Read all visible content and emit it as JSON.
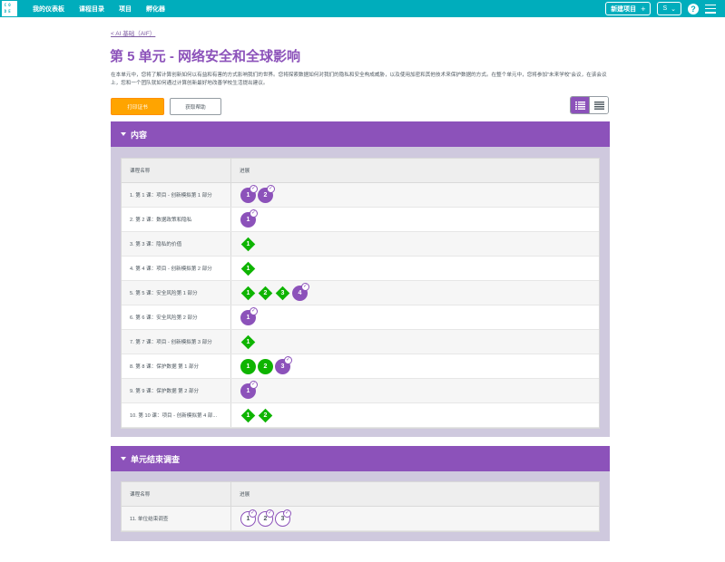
{
  "header": {
    "logo_letters": [
      "C",
      "O",
      "",
      "D",
      "E",
      ""
    ],
    "nav": [
      "我的仪表板",
      "课程目录",
      "项目",
      "孵化器"
    ],
    "new_project_label": "新建项目",
    "new_project_icon": "plus-icon",
    "user_label": "S",
    "help_label": "?"
  },
  "breadcrumb": "< AI 基础（AIF）",
  "title": "第 5 单元 - 网络安全和全球影响",
  "description": "在本单元中，您将了解计算创新如何以有益和有害的方式影响我们的世界。您将探索数据如何对我们的隐私和安全构成威胁，以及使用加密和其他技术来保护数据的方式。在整个单元中，您将参加\"未来学校\"会议，在该会议上，您和一个团队就如何通过计算创新最好地改善学校生活提出建议。",
  "buttons": {
    "print": "打印证书",
    "help": "获取帮助"
  },
  "colors": {
    "brand": "#00adbc",
    "purple": "#8c52ba",
    "green": "#0eb400",
    "orange": "#ffa400"
  },
  "sections": [
    {
      "title": "内容",
      "col_name": "课程名称",
      "col_progress": "进展",
      "rows": [
        {
          "name": "1. 第 1 课：项目 - 创新模拟第 1 部分",
          "levels": [
            {
              "n": "1",
              "kind": "circle",
              "checked": true
            },
            {
              "n": "2",
              "kind": "circle",
              "checked": true
            }
          ]
        },
        {
          "name": "2. 第 2 课：数据政策和隐私",
          "levels": [
            {
              "n": "1",
              "kind": "circle",
              "checked": true
            }
          ]
        },
        {
          "name": "3. 第 3 课：隐私的价值",
          "levels": [
            {
              "n": "1",
              "kind": "diamond",
              "checked": false
            }
          ]
        },
        {
          "name": "4. 第 4 课：项目 - 创新模拟第 2 部分",
          "levels": [
            {
              "n": "1",
              "kind": "diamond",
              "checked": false
            }
          ]
        },
        {
          "name": "5. 第 5 课：安全风险第 1 部分",
          "levels": [
            {
              "n": "1",
              "kind": "diamond",
              "checked": false
            },
            {
              "n": "2",
              "kind": "diamond",
              "checked": false
            },
            {
              "n": "3",
              "kind": "diamond",
              "checked": false
            },
            {
              "n": "4",
              "kind": "circle",
              "checked": true
            }
          ]
        },
        {
          "name": "6. 第 6 课：安全风险第 2 部分",
          "levels": [
            {
              "n": "1",
              "kind": "circle",
              "checked": true
            }
          ]
        },
        {
          "name": "7. 第 7 课：项目 - 创新模拟第 3 部分",
          "levels": [
            {
              "n": "1",
              "kind": "diamond",
              "checked": false
            }
          ]
        },
        {
          "name": "8. 第 8 课：保护数据 第 1 部分",
          "levels": [
            {
              "n": "1",
              "kind": "green",
              "checked": false
            },
            {
              "n": "2",
              "kind": "green",
              "checked": false
            },
            {
              "n": "3",
              "kind": "circle",
              "checked": true
            }
          ]
        },
        {
          "name": "9. 第 9 课：保护数据 第 2 部分",
          "levels": [
            {
              "n": "1",
              "kind": "circle",
              "checked": true
            }
          ]
        },
        {
          "name": "10. 第 10 课：项目 - 创新模拟第 4 部...",
          "levels": [
            {
              "n": "1",
              "kind": "diamond",
              "checked": false
            },
            {
              "n": "2",
              "kind": "diamond",
              "checked": false
            }
          ]
        }
      ]
    },
    {
      "title": "单元结束调查",
      "col_name": "课程名称",
      "col_progress": "进展",
      "rows": [
        {
          "name": "11. 单位结束调查",
          "levels": [
            {
              "n": "1",
              "kind": "outline",
              "checked": true
            },
            {
              "n": "2",
              "kind": "outline",
              "checked": true
            },
            {
              "n": "3",
              "kind": "outline",
              "checked": true
            }
          ]
        }
      ]
    }
  ]
}
